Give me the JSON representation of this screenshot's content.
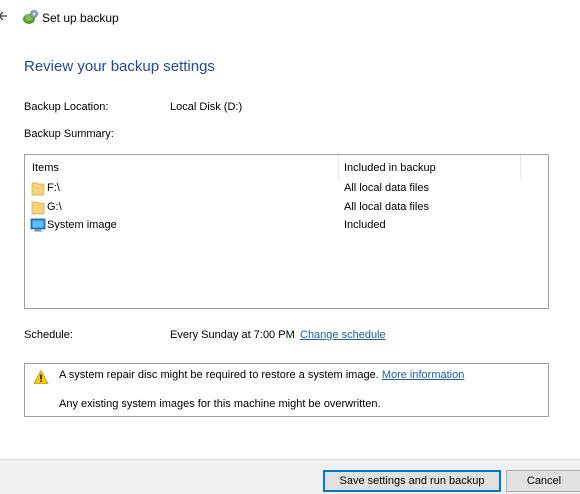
{
  "window": {
    "title": "Set up backup"
  },
  "page": {
    "heading": "Review your backup settings"
  },
  "settings": {
    "location_label": "Backup Location:",
    "location_value": "Local Disk (D:)",
    "summary_label": "Backup Summary:"
  },
  "summary_table": {
    "columns": [
      "Items",
      "Included in backup"
    ],
    "rows": [
      {
        "item": "F:\\",
        "included": "All local data files",
        "icon": "folder-icon"
      },
      {
        "item": "G:\\",
        "included": "All local data files",
        "icon": "folder-icon"
      },
      {
        "item": "System image",
        "included": "Included",
        "icon": "monitor-icon"
      }
    ]
  },
  "schedule": {
    "label": "Schedule:",
    "value": "Every Sunday at 7:00 PM",
    "change_link": "Change schedule"
  },
  "notice": {
    "line1": "A system repair disc might be required to restore a system image.",
    "more_link": "More information",
    "line2": "Any existing system images for this machine might be overwritten."
  },
  "footer": {
    "save_label": "Save settings and run backup",
    "cancel_label": "Cancel"
  },
  "colors": {
    "heading": "#1e4a9a",
    "link": "#1a5fb4",
    "folder": "#f6d27a",
    "warning": "#f2c811",
    "button_focus": "#0078d7"
  }
}
